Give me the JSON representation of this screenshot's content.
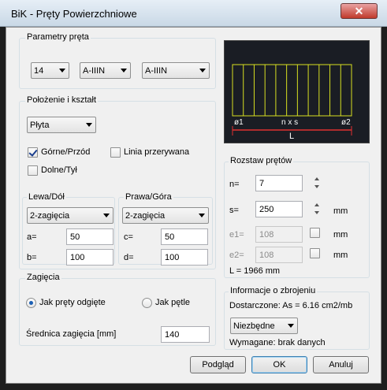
{
  "window": {
    "title": "BiK - Pręty Powierzchniowe",
    "close_glyph": "✕"
  },
  "params": {
    "label": "Parametry pręta",
    "diameter": "14",
    "steel1": "A-IIIN",
    "steel2": "A-IIIN"
  },
  "position": {
    "label": "Położenie i kształt",
    "shape": "Płyta",
    "top_front": {
      "label": "Górne/Przód",
      "checked": true
    },
    "dashed_line": {
      "label": "Linia przerywana",
      "checked": false
    },
    "bottom_back": {
      "label": "Dolne/Tył",
      "checked": false
    },
    "left": {
      "label": "Lewa/Dół",
      "bend": "2-zagięcia",
      "a_label": "a=",
      "a": "50",
      "b_label": "b=",
      "b": "100"
    },
    "right": {
      "label": "Prawa/Góra",
      "bend": "2-zagięcia",
      "c_label": "c=",
      "c": "50",
      "d_label": "d=",
      "d": "100"
    }
  },
  "bends": {
    "label": "Zagięcia",
    "opt1": {
      "label": "Jak pręty odgięte",
      "selected": true
    },
    "opt2": {
      "label": "Jak pętle",
      "selected": false
    },
    "diameter_label": "Średnica zagięcia [mm]",
    "diameter": "140"
  },
  "preview": {
    "left_label": "ø1",
    "middle_label": "n x s",
    "right_label": "ø2",
    "length_label": "L",
    "bar_count": 11,
    "bar_color": "#d8e021",
    "dim_color": "#e03030"
  },
  "spacing": {
    "label": "Rozstaw prętów",
    "n_label": "n=",
    "n": "7",
    "s_label": "s=",
    "s": "250",
    "s_unit": "mm",
    "e1_label": "e1=",
    "e1": "108",
    "e1_unit": "mm",
    "e2_label": "e2=",
    "e2": "108",
    "e2_unit": "mm",
    "length": "L = 1966 mm"
  },
  "info": {
    "label": "Informacje o zbrojeniu",
    "provided": "Dostarczone: As = 6.16 cm2/mb",
    "requirement": "Niezbędne",
    "required": "Wymagane: brak danych"
  },
  "buttons": {
    "preview": "Podgląd",
    "ok": "OK",
    "cancel": "Anuluj"
  }
}
